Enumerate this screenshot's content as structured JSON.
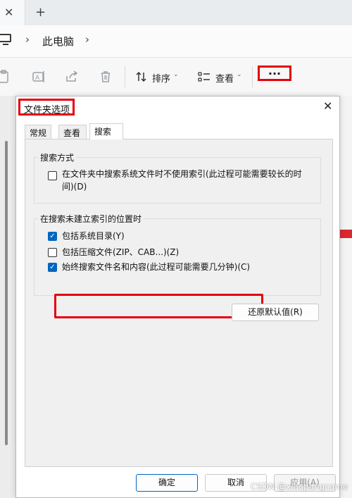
{
  "explorer": {
    "tab_close_glyph": "✕",
    "new_tab_glyph": "+",
    "breadcrumb": {
      "chevron": "›",
      "location": "此电脑"
    },
    "toolbar": {
      "sort_label": "排序",
      "view_label": "查看",
      "dropdown_glyph": "⌄",
      "more_label": "..."
    }
  },
  "dialog": {
    "title": "文件夹选项",
    "close_glyph": "✕",
    "tabs": [
      {
        "label": "常规",
        "active": false
      },
      {
        "label": "查看",
        "active": false
      },
      {
        "label": "搜索",
        "active": true
      }
    ],
    "search_method": {
      "title": "搜索方式",
      "options": [
        {
          "label": "在文件夹中搜索系统文件时不使用索引(此过程可能需要较长的时间)(D)",
          "checked": false
        }
      ]
    },
    "non_indexed": {
      "title": "在搜索未建立索引的位置时",
      "options": [
        {
          "label": "包括系统目录(Y)",
          "checked": true
        },
        {
          "label": "包括压缩文件(ZIP、CAB...)(Z)",
          "checked": false
        },
        {
          "label": "始终搜索文件名和内容(此过程可能需要几分钟)(C)",
          "checked": true
        }
      ]
    },
    "restore_button": "还原默认值(R)",
    "buttons": {
      "ok": "确定",
      "cancel": "取消",
      "apply": "应用(A)"
    }
  },
  "watermark": "CSDN @xiaopangcame",
  "colors": {
    "accent": "#0067c0",
    "highlight_red": "#e5000a"
  }
}
